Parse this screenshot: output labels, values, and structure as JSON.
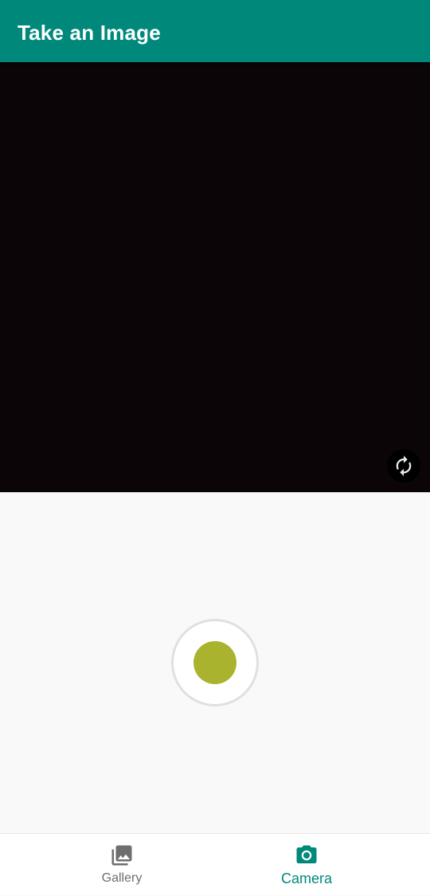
{
  "app_bar": {
    "title": "Take an Image"
  },
  "camera": {
    "switch_icon": "camera-switch-icon"
  },
  "shutter": {
    "color": "#aab32d"
  },
  "bottom_nav": {
    "items": [
      {
        "label": "Gallery",
        "icon": "photo-library-icon",
        "active": false
      },
      {
        "label": "Camera",
        "icon": "camera-icon",
        "active": true
      }
    ]
  },
  "colors": {
    "primary": "#00897b",
    "inactive": "#6e6e6e",
    "preview_background": "#0b0508"
  }
}
